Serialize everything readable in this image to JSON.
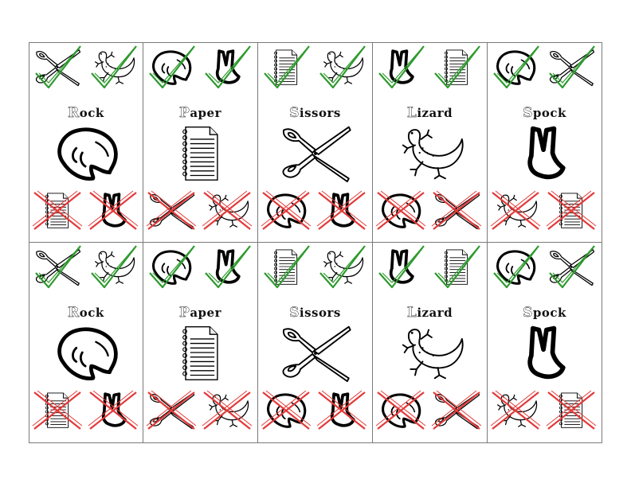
{
  "colors": {
    "border": "#7a7a7a",
    "win_mark": "#2e9a2e",
    "lose_mark": "#e33a3a",
    "ink": "#000000"
  },
  "cards": [
    {
      "title_cap": "R",
      "title_rest": "ock",
      "main_icon": "rock-icon",
      "beats": [
        "scissors-icon",
        "lizard-icon"
      ],
      "loses_to": [
        "paper-icon",
        "spock-icon"
      ]
    },
    {
      "title_cap": "P",
      "title_rest": "aper",
      "main_icon": "paper-icon",
      "beats": [
        "rock-icon",
        "spock-icon"
      ],
      "loses_to": [
        "scissors-icon",
        "lizard-icon"
      ]
    },
    {
      "title_cap": "S",
      "title_rest": "issors",
      "main_icon": "scissors-icon",
      "beats": [
        "paper-icon",
        "lizard-icon"
      ],
      "loses_to": [
        "rock-icon",
        "spock-icon"
      ]
    },
    {
      "title_cap": "L",
      "title_rest": "izard",
      "main_icon": "lizard-icon",
      "beats": [
        "spock-icon",
        "paper-icon"
      ],
      "loses_to": [
        "rock-icon",
        "scissors-icon"
      ]
    },
    {
      "title_cap": "S",
      "title_rest": "pock",
      "main_icon": "spock-icon",
      "beats": [
        "rock-icon",
        "scissors-icon"
      ],
      "loses_to": [
        "lizard-icon",
        "paper-icon"
      ]
    },
    {
      "title_cap": "R",
      "title_rest": "ock",
      "main_icon": "rock-icon",
      "beats": [
        "scissors-icon",
        "lizard-icon"
      ],
      "loses_to": [
        "paper-icon",
        "spock-icon"
      ]
    },
    {
      "title_cap": "P",
      "title_rest": "aper",
      "main_icon": "paper-icon",
      "beats": [
        "rock-icon",
        "spock-icon"
      ],
      "loses_to": [
        "scissors-icon",
        "lizard-icon"
      ]
    },
    {
      "title_cap": "S",
      "title_rest": "issors",
      "main_icon": "scissors-icon",
      "beats": [
        "paper-icon",
        "lizard-icon"
      ],
      "loses_to": [
        "rock-icon",
        "spock-icon"
      ]
    },
    {
      "title_cap": "L",
      "title_rest": "izard",
      "main_icon": "lizard-icon",
      "beats": [
        "spock-icon",
        "paper-icon"
      ],
      "loses_to": [
        "rock-icon",
        "scissors-icon"
      ]
    },
    {
      "title_cap": "S",
      "title_rest": "pock",
      "main_icon": "spock-icon",
      "beats": [
        "rock-icon",
        "scissors-icon"
      ],
      "loses_to": [
        "lizard-icon",
        "paper-icon"
      ]
    }
  ]
}
